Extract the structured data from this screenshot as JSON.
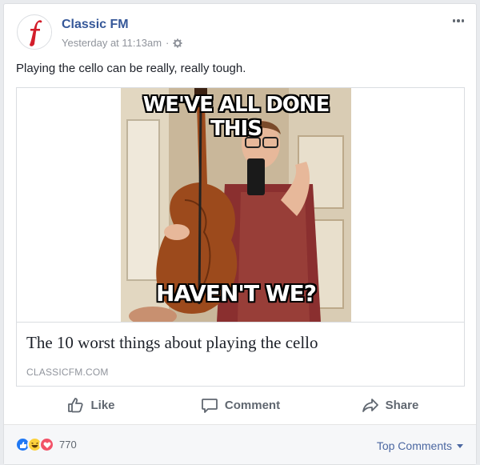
{
  "post": {
    "page_name": "Classic FM",
    "timestamp": "Yesterday at 11:13am",
    "separator": "·",
    "text": "Playing the cello can be really, really tough."
  },
  "link": {
    "meme_top": "WE'VE ALL DONE THIS",
    "meme_bottom": "HAVEN'T WE?",
    "title": "The 10 worst things about playing the cello",
    "domain": "CLASSICFM.COM"
  },
  "actions": {
    "like": "Like",
    "comment": "Comment",
    "share": "Share"
  },
  "footer": {
    "reaction_count": "770",
    "reactions": [
      "like-icon",
      "haha-icon",
      "love-icon"
    ],
    "sort_label": "Top Comments"
  },
  "colors": {
    "link_blue": "#365899",
    "like_blue": "#2078f4",
    "love_red": "#f25268",
    "haha_yellow": "#fcd13c",
    "brand_red": "#d31d2a"
  }
}
